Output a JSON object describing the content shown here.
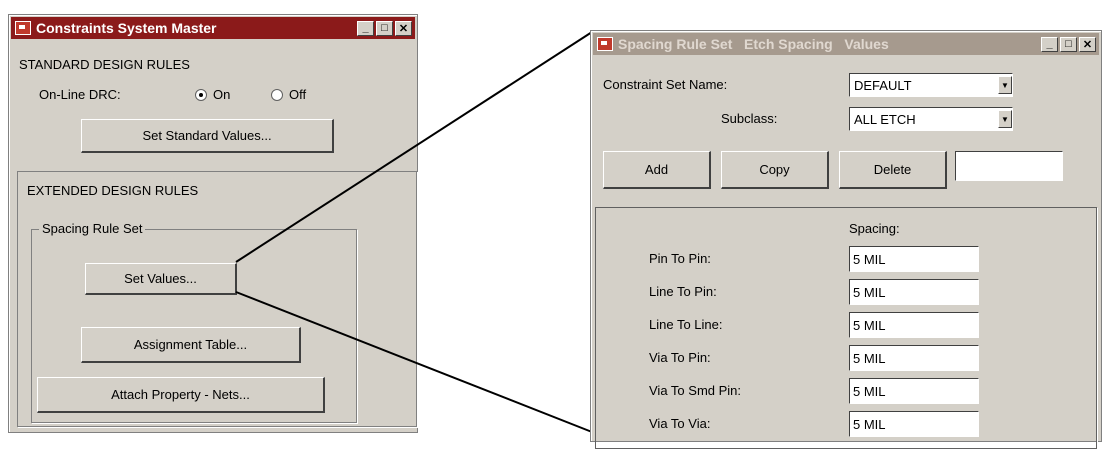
{
  "left_window": {
    "title": "Constraints System Master",
    "standard_header": "STANDARD DESIGN RULES",
    "online_drc_label": "On-Line DRC:",
    "radio_on": "On",
    "radio_off": "Off",
    "set_standard_values": "Set Standard Values...",
    "extended_header": "EXTENDED DESIGN RULES",
    "spacing_group_label": "Spacing Rule Set",
    "set_values": "Set Values...",
    "assignment_table": "Assignment Table...",
    "attach_property": "Attach Property - Nets..."
  },
  "right_window": {
    "title": "Spacing Rule Set   Etch Spacing   Values",
    "constraint_set_label": "Constraint Set Name:",
    "constraint_set_value": "DEFAULT",
    "subclass_label": "Subclass:",
    "subclass_value": "ALL ETCH",
    "add": "Add",
    "copy": "Copy",
    "delete": "Delete",
    "delete_input_value": "",
    "spacing_header": "Spacing:",
    "rows": [
      {
        "label": "Pin To Pin:",
        "value": "5 MIL"
      },
      {
        "label": "Line To Pin:",
        "value": "5 MIL"
      },
      {
        "label": "Line To Line:",
        "value": "5 MIL"
      },
      {
        "label": "Via To Pin:",
        "value": "5 MIL"
      },
      {
        "label": "Via To Smd Pin:",
        "value": "5 MIL"
      },
      {
        "label": "Via To Via:",
        "value": "5 MIL"
      }
    ]
  },
  "colors": {
    "window_bg": "#d4d0c8",
    "title_active": "#8b1a1a",
    "title_inactive": "#a69a8e"
  }
}
